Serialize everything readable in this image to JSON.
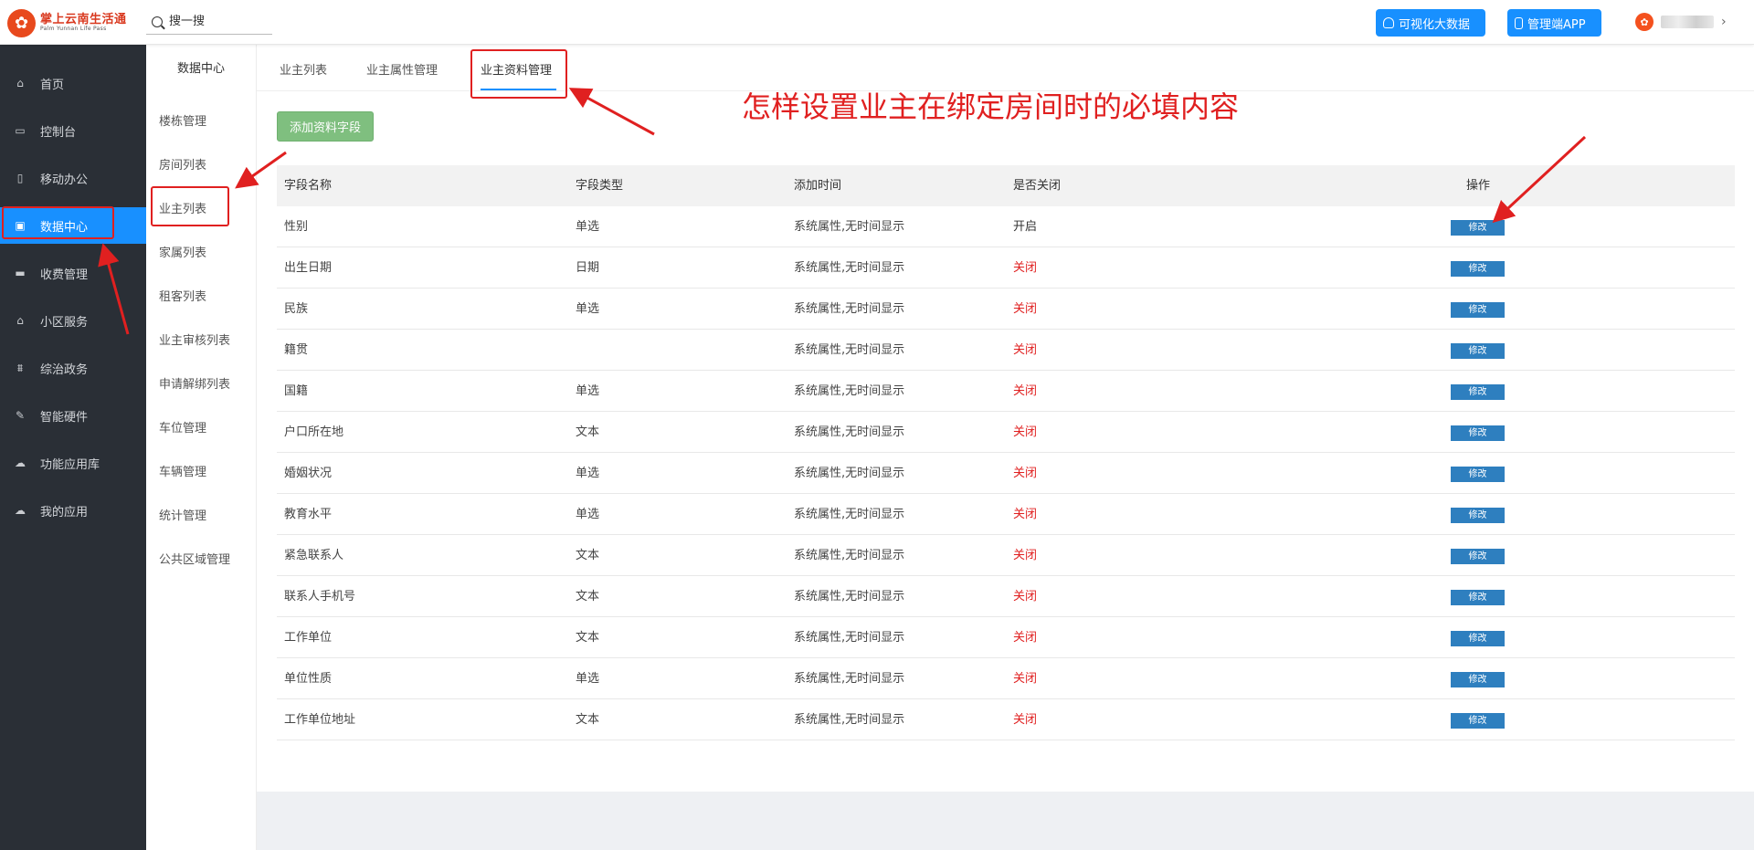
{
  "header": {
    "logo_cn": "掌上云南生活通",
    "logo_en": "Palm Yunnan Life Pass",
    "search_placeholder": "搜一搜",
    "btn_visual": "可视化大数据",
    "btn_app": "管理端APP"
  },
  "sidebar": {
    "items": [
      {
        "label": "首页",
        "icon": "home-icon",
        "glyph": "⌂"
      },
      {
        "label": "控制台",
        "icon": "laptop-icon",
        "glyph": "▭"
      },
      {
        "label": "移动办公",
        "icon": "mobile-icon",
        "glyph": "▯"
      },
      {
        "label": "数据中心",
        "icon": "briefcase-icon",
        "glyph": "▣"
      },
      {
        "label": "收费管理",
        "icon": "credit-card-icon",
        "glyph": "▬"
      },
      {
        "label": "小区服务",
        "icon": "home-icon",
        "glyph": "⌂"
      },
      {
        "label": "综治政务",
        "icon": "bank-icon",
        "glyph": "⩩"
      },
      {
        "label": "智能硬件",
        "icon": "wrench-icon",
        "glyph": "✎"
      },
      {
        "label": "功能应用库",
        "icon": "cloud-download-icon",
        "glyph": "☁"
      },
      {
        "label": "我的应用",
        "icon": "cloud-icon",
        "glyph": "☁"
      }
    ],
    "active_index": 3
  },
  "subnav": {
    "title": "数据中心",
    "items": [
      "楼栋管理",
      "房间列表",
      "业主列表",
      "家属列表",
      "租客列表",
      "业主审核列表",
      "申请解绑列表",
      "车位管理",
      "车辆管理",
      "统计管理",
      "公共区域管理"
    ]
  },
  "tabs": [
    "业主列表",
    "业主属性管理",
    "业主资料管理"
  ],
  "add_button": "添加资料字段",
  "annotation": "怎样设置业主在绑定房间时的必填内容",
  "table": {
    "headers": [
      "字段名称",
      "字段类型",
      "添加时间",
      "是否关闭",
      "操作"
    ],
    "edit_label": "修改",
    "rows": [
      {
        "name": "性别",
        "type": "单选",
        "time": "系统属性,无时间显示",
        "status": "开启",
        "on": true
      },
      {
        "name": "出生日期",
        "type": "日期",
        "time": "系统属性,无时间显示",
        "status": "关闭",
        "on": false
      },
      {
        "name": "民族",
        "type": "单选",
        "time": "系统属性,无时间显示",
        "status": "关闭",
        "on": false
      },
      {
        "name": "籍贯",
        "type": "",
        "time": "系统属性,无时间显示",
        "status": "关闭",
        "on": false
      },
      {
        "name": "国籍",
        "type": "单选",
        "time": "系统属性,无时间显示",
        "status": "关闭",
        "on": false
      },
      {
        "name": "户口所在地",
        "type": "文本",
        "time": "系统属性,无时间显示",
        "status": "关闭",
        "on": false
      },
      {
        "name": "婚姻状况",
        "type": "单选",
        "time": "系统属性,无时间显示",
        "status": "关闭",
        "on": false
      },
      {
        "name": "教育水平",
        "type": "单选",
        "time": "系统属性,无时间显示",
        "status": "关闭",
        "on": false
      },
      {
        "name": "紧急联系人",
        "type": "文本",
        "time": "系统属性,无时间显示",
        "status": "关闭",
        "on": false
      },
      {
        "name": "联系人手机号",
        "type": "文本",
        "time": "系统属性,无时间显示",
        "status": "关闭",
        "on": false
      },
      {
        "name": "工作单位",
        "type": "文本",
        "time": "系统属性,无时间显示",
        "status": "关闭",
        "on": false
      },
      {
        "name": "单位性质",
        "type": "单选",
        "time": "系统属性,无时间显示",
        "status": "关闭",
        "on": false
      },
      {
        "name": "工作单位地址",
        "type": "文本",
        "time": "系统属性,无时间显示",
        "status": "关闭",
        "on": false
      }
    ]
  },
  "colors": {
    "primary": "#1890ff",
    "closed": "#e02020",
    "annotation": "#e02020",
    "edit_button": "#2e7fbf",
    "add_button": "#7fbf7f"
  }
}
